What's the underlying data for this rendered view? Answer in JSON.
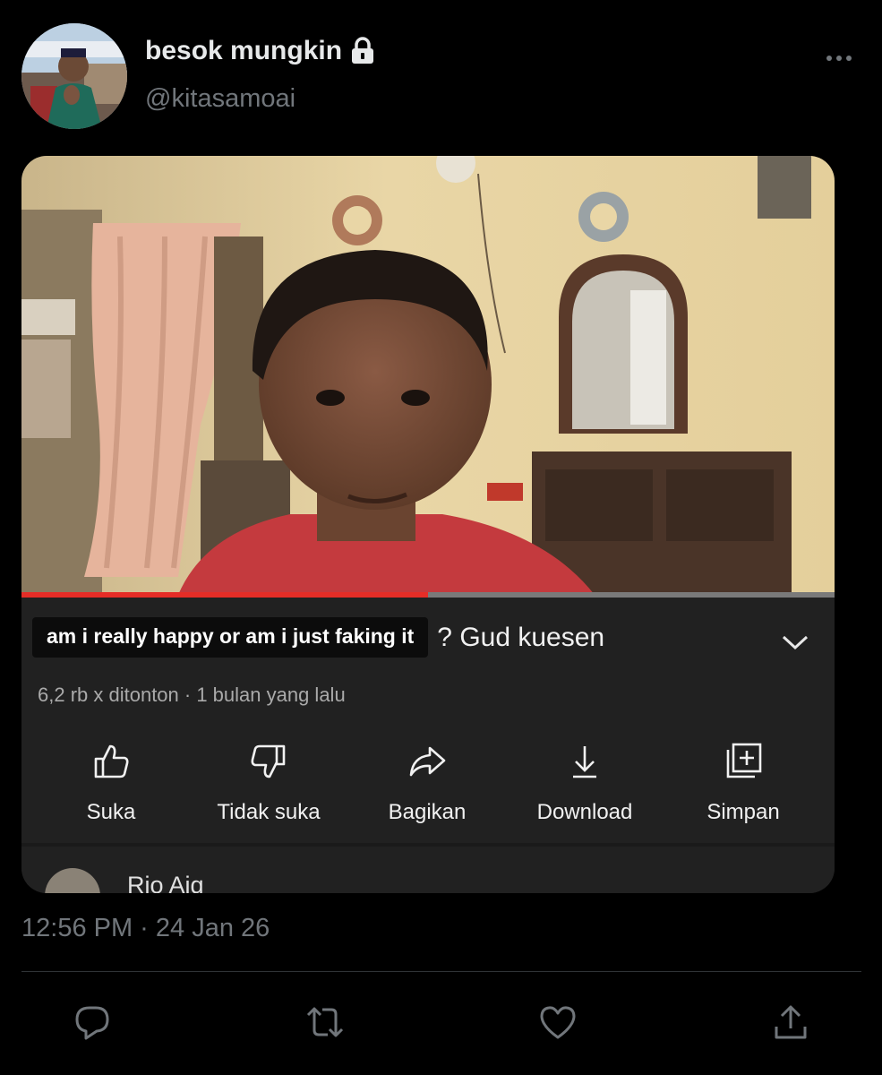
{
  "author": {
    "display_name": "besok mungkin",
    "handle": "@kitasamoai",
    "protected_icon": "lock-icon",
    "menu_icon": "more-horizontal-icon"
  },
  "video": {
    "caption": "am i really happy or am i just faking it",
    "title_suffix": "? Gud kuesen",
    "meta": "6,2 rb x ditonton · 1 bulan yang lalu",
    "progress": 0.5,
    "progress_color": "#e52d27",
    "actions": [
      {
        "label": "Suka",
        "icon": "thumbs-up-icon"
      },
      {
        "label": "Tidak suka",
        "icon": "thumbs-down-icon"
      },
      {
        "label": "Bagikan",
        "icon": "share-icon"
      },
      {
        "label": "Download",
        "icon": "download-icon"
      },
      {
        "label": "Simpan",
        "icon": "save-playlist-icon"
      }
    ],
    "comment_author": "Rio Aiq"
  },
  "tweet": {
    "timestamp": "12:56 PM · 24 Jan 26",
    "actions": [
      "reply-icon",
      "retweet-icon",
      "like-icon",
      "share-icon"
    ]
  },
  "colors": {
    "background": "#000000",
    "secondary_text": "#71767b",
    "panel": "#212121"
  }
}
